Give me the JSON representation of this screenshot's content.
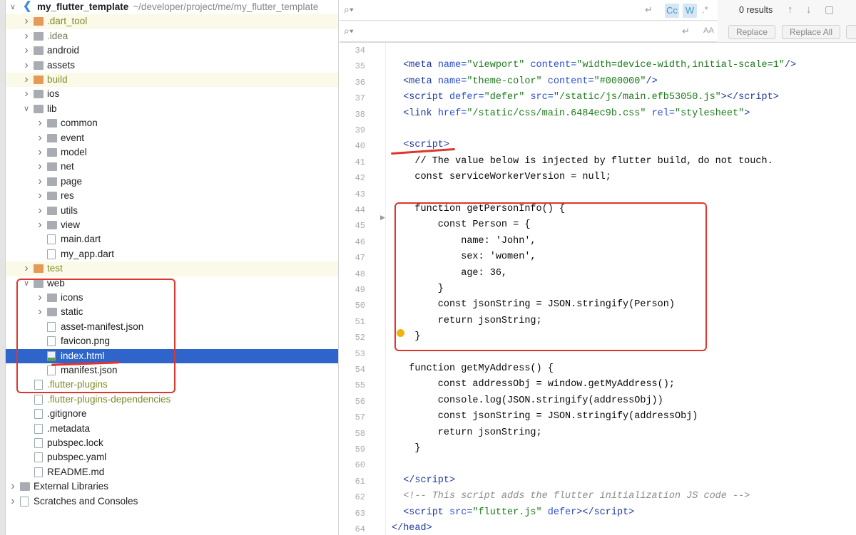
{
  "project_tree": {
    "root": {
      "name": "my_flutter_template",
      "path": "~/developer/project/me/my_flutter_template"
    },
    "items": [
      {
        "label": ".dart_tool",
        "level": 1,
        "kind": "folder-orange",
        "expandable": true,
        "excluded": true
      },
      {
        "label": ".idea",
        "level": 1,
        "kind": "folder",
        "expandable": true,
        "muted": true
      },
      {
        "label": "android",
        "level": 1,
        "kind": "folder",
        "expandable": true
      },
      {
        "label": "assets",
        "level": 1,
        "kind": "folder",
        "expandable": true
      },
      {
        "label": "build",
        "level": 1,
        "kind": "folder-orange",
        "expandable": true,
        "excluded": true
      },
      {
        "label": "ios",
        "level": 1,
        "kind": "folder",
        "expandable": true
      },
      {
        "label": "lib",
        "level": 1,
        "kind": "folder",
        "expandable": true,
        "expanded": true
      },
      {
        "label": "common",
        "level": 2,
        "kind": "folder",
        "expandable": true
      },
      {
        "label": "event",
        "level": 2,
        "kind": "folder",
        "expandable": true
      },
      {
        "label": "model",
        "level": 2,
        "kind": "folder",
        "expandable": true
      },
      {
        "label": "net",
        "level": 2,
        "kind": "folder",
        "expandable": true
      },
      {
        "label": "page",
        "level": 2,
        "kind": "folder",
        "expandable": true
      },
      {
        "label": "res",
        "level": 2,
        "kind": "folder",
        "expandable": true
      },
      {
        "label": "utils",
        "level": 2,
        "kind": "folder",
        "expandable": true
      },
      {
        "label": "view",
        "level": 2,
        "kind": "folder",
        "expandable": true
      },
      {
        "label": "main.dart",
        "level": 2,
        "kind": "file"
      },
      {
        "label": "my_app.dart",
        "level": 2,
        "kind": "file"
      },
      {
        "label": "test",
        "level": 1,
        "kind": "folder-orange",
        "expandable": true,
        "excluded": true
      },
      {
        "label": "web",
        "level": 1,
        "kind": "folder",
        "expandable": true,
        "expanded": true
      },
      {
        "label": "icons",
        "level": 2,
        "kind": "folder",
        "expandable": true
      },
      {
        "label": "static",
        "level": 2,
        "kind": "folder",
        "expandable": true
      },
      {
        "label": "asset-manifest.json",
        "level": 2,
        "kind": "file"
      },
      {
        "label": "favicon.png",
        "level": 2,
        "kind": "file"
      },
      {
        "label": "index.html",
        "level": 2,
        "kind": "html",
        "selected": true
      },
      {
        "label": "manifest.json",
        "level": 2,
        "kind": "file"
      },
      {
        "label": ".flutter-plugins",
        "level": 1,
        "kind": "file",
        "ignored": true
      },
      {
        "label": ".flutter-plugins-dependencies",
        "level": 1,
        "kind": "file",
        "ignored": true
      },
      {
        "label": ".gitignore",
        "level": 1,
        "kind": "file"
      },
      {
        "label": ".metadata",
        "level": 1,
        "kind": "file"
      },
      {
        "label": "pubspec.lock",
        "level": 1,
        "kind": "file"
      },
      {
        "label": "pubspec.yaml",
        "level": 1,
        "kind": "file"
      },
      {
        "label": "README.md",
        "level": 1,
        "kind": "file"
      },
      {
        "label": "External Libraries",
        "level": 0,
        "kind": "library",
        "expandable": true
      },
      {
        "label": "Scratches and Consoles",
        "level": 0,
        "kind": "scratch",
        "expandable": true
      }
    ]
  },
  "search_bar": {
    "find_placeholder": "",
    "replace_placeholder": "",
    "match_case": "Cc",
    "words": "W",
    "regex": ".*",
    "preserve_case": "AA",
    "results": "0 results",
    "replace_label": "Replace",
    "replace_all_label": "Replace All"
  },
  "editor": {
    "first_line": 34,
    "lines": [
      [],
      [
        [
          "  ",
          ""
        ],
        [
          "<meta ",
          "tag"
        ],
        [
          "name=",
          "attr"
        ],
        [
          "\"viewport\" ",
          "str"
        ],
        [
          "content=",
          "attr"
        ],
        [
          "\"width=device-width,initial-scale=1\"",
          "str"
        ],
        [
          "/>",
          "tag"
        ]
      ],
      [
        [
          "  ",
          ""
        ],
        [
          "<meta ",
          "tag"
        ],
        [
          "name=",
          "attr"
        ],
        [
          "\"theme-color\" ",
          "str"
        ],
        [
          "content=",
          "attr"
        ],
        [
          "\"#000000\"",
          "str"
        ],
        [
          "/>",
          "tag"
        ]
      ],
      [
        [
          "  ",
          ""
        ],
        [
          "<script ",
          "tag"
        ],
        [
          "defer=",
          "attr"
        ],
        [
          "\"defer\" ",
          "str"
        ],
        [
          "src=",
          "attr"
        ],
        [
          "\"/static/js/main.efb53050.js\"",
          "str"
        ],
        [
          "></script>",
          "tag"
        ]
      ],
      [
        [
          "  ",
          ""
        ],
        [
          "<link ",
          "tag"
        ],
        [
          "href=",
          "attr"
        ],
        [
          "\"/static/css/main.6484ec9b.css\" ",
          "str"
        ],
        [
          "rel=",
          "attr"
        ],
        [
          "\"stylesheet\"",
          "str"
        ],
        [
          ">",
          "tag"
        ]
      ],
      [],
      [
        [
          "  ",
          ""
        ],
        [
          "<script>",
          "tag"
        ]
      ],
      [
        [
          "    // The value below is injected by flutter build, do not touch.",
          ""
        ]
      ],
      [
        [
          "    const serviceWorkerVersion = null;",
          ""
        ]
      ],
      [],
      [
        [
          "    function getPersonInfo() {",
          ""
        ]
      ],
      [
        [
          "        const Person = {",
          ""
        ]
      ],
      [
        [
          "            name: 'John',",
          ""
        ]
      ],
      [
        [
          "            sex: 'women',",
          ""
        ]
      ],
      [
        [
          "            age: 36,",
          ""
        ]
      ],
      [
        [
          "        }",
          ""
        ]
      ],
      [
        [
          "        const jsonString = JSON.stringify(Person)",
          ""
        ]
      ],
      [
        [
          "        return jsonString;",
          ""
        ]
      ],
      [
        [
          "    }",
          ""
        ]
      ],
      [],
      [
        [
          "   function getMyAddress() {",
          ""
        ]
      ],
      [
        [
          "        const addressObj = window.getMyAddress();",
          ""
        ]
      ],
      [
        [
          "        console.log(JSON.stringify(addressObj))",
          ""
        ]
      ],
      [
        [
          "        const jsonString = JSON.stringify(addressObj)",
          ""
        ]
      ],
      [
        [
          "        return jsonString;",
          ""
        ]
      ],
      [
        [
          "    }",
          ""
        ]
      ],
      [],
      [
        [
          "  ",
          ""
        ],
        [
          "</script>",
          "tag"
        ]
      ],
      [
        [
          "  ",
          ""
        ],
        [
          "<!-- This script adds the flutter initialization JS code -->",
          "cmt"
        ]
      ],
      [
        [
          "  ",
          ""
        ],
        [
          "<script ",
          "tag"
        ],
        [
          "src=",
          "attr"
        ],
        [
          "\"flutter.js\" ",
          "str"
        ],
        [
          "defer",
          "attr"
        ],
        [
          "></script>",
          "tag"
        ]
      ],
      [
        [
          "</head>",
          "tag"
        ]
      ]
    ]
  }
}
